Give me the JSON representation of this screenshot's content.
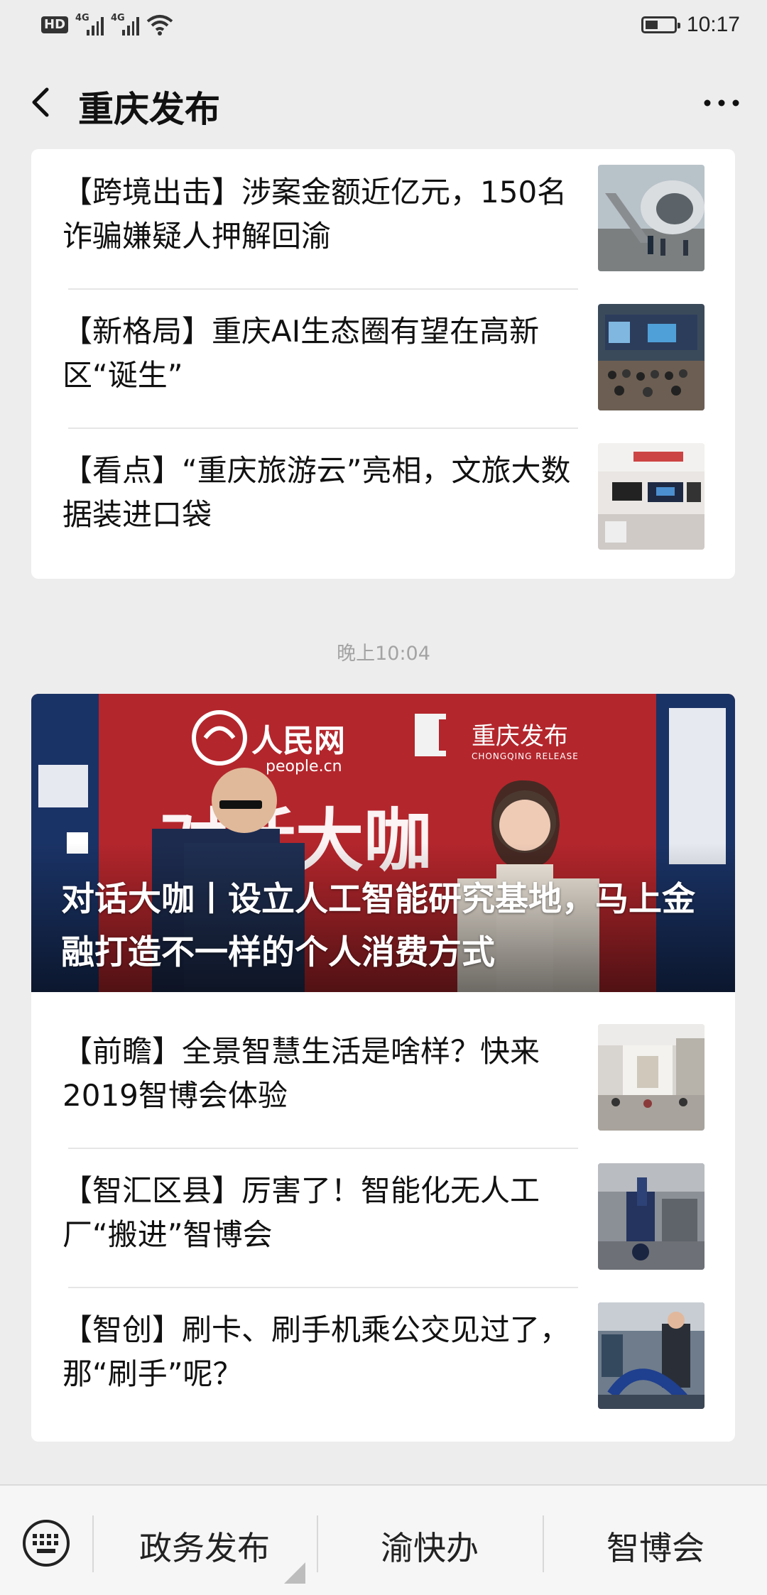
{
  "status_bar": {
    "hd": "HD",
    "net1": "4G",
    "net2": "4G",
    "time": "10:17",
    "battery_level": 0.45
  },
  "header": {
    "title": "重庆发布"
  },
  "card1": {
    "items": [
      {
        "title": "【跨境出击】涉案金额近亿元，150名诈骗嫌疑人押解回渝",
        "thumb_icon": "airplane-stairs-photo"
      },
      {
        "title": "【新格局】重庆AI生态圈有望在高新区“诞生”",
        "thumb_icon": "conference-hall-photo"
      },
      {
        "title": "【看点】“重庆旅游云”亮相，文旅大数据装进口袋",
        "thumb_icon": "exhibition-booth-photo"
      }
    ]
  },
  "timestamp": "晚上10:04",
  "card2": {
    "hero": {
      "title": "对话大咖丨设立人工智能研究基地，马上金融打造不一样的个人消费方式",
      "banner_logo_text": "人民网",
      "banner_logo_sub": "people.cn",
      "banner_brand": "重庆发布",
      "banner_brand_sub": "CHONGQING RELEASE",
      "banner_slogan": "对话大咖"
    },
    "items": [
      {
        "title": "【前瞻】全景智慧生活是啥样？快来2019智博会体验",
        "thumb_icon": "expo-hall-photo"
      },
      {
        "title": "【智汇区县】厉害了！智能化无人工厂“搬进”智博会",
        "thumb_icon": "robot-arm-photo"
      },
      {
        "title": "【智创】刷卡、刷手机乘公交见过了，那“刷手”呢？",
        "thumb_icon": "expo-visitors-photo"
      }
    ]
  },
  "bottom_bar": {
    "tabs": [
      "政务发布",
      "渝快办",
      "智博会"
    ]
  }
}
